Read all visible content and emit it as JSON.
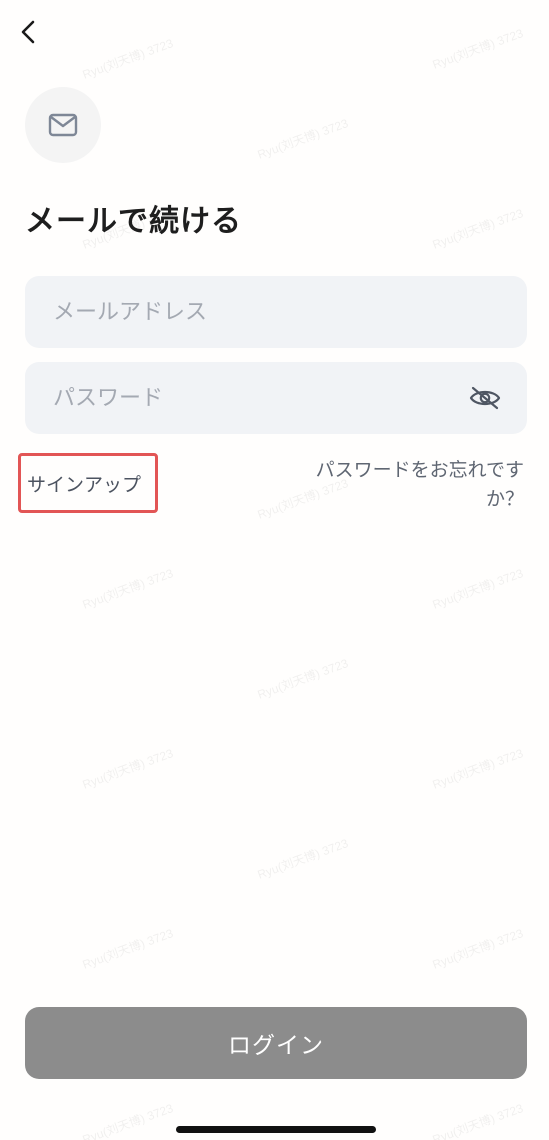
{
  "header": {
    "back_icon": "chevron-left-icon"
  },
  "badge": {
    "icon": "envelope-icon"
  },
  "title": "メールで続ける",
  "form": {
    "email": {
      "value": "",
      "placeholder": "メールアドレス"
    },
    "password": {
      "value": "",
      "placeholder": "パスワード",
      "visibility_icon": "eye-off-icon"
    }
  },
  "links": {
    "signup": "サインアップ",
    "forgot_password": "パスワードをお忘れですか？"
  },
  "actions": {
    "login": "ログイン"
  },
  "watermark": "Ryu(刘天博) 3723",
  "colors": {
    "highlight": "#e25555",
    "button": "#8c8c8c",
    "field": "#f1f3f6"
  }
}
